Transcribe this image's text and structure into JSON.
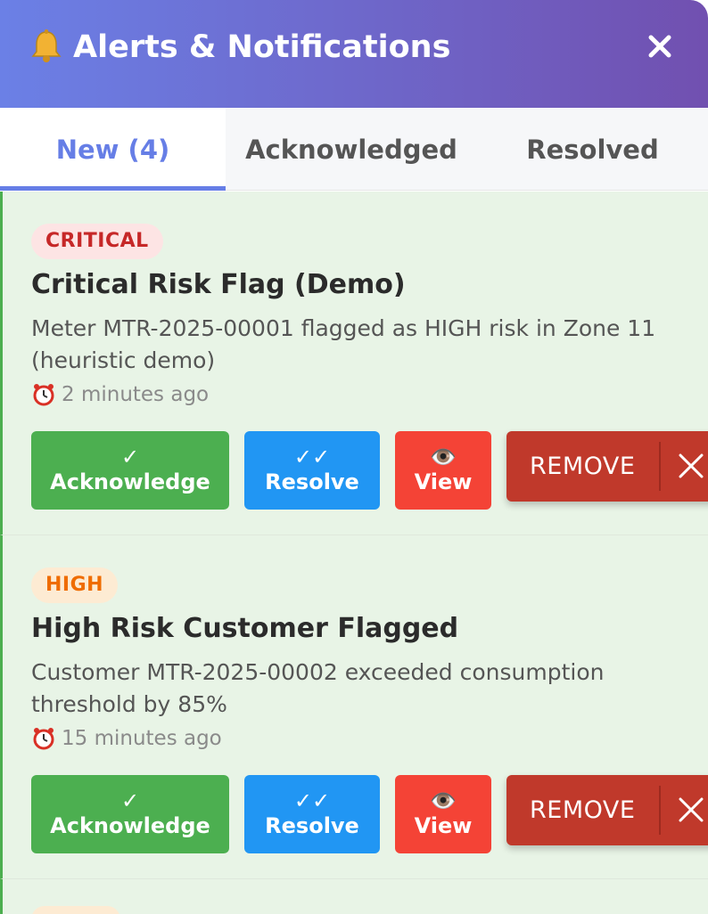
{
  "header": {
    "title": "Alerts & Notifications",
    "bell_icon": "bell-icon",
    "close_icon": "close-icon",
    "gradient": [
      "#6b80e6",
      "#7150b0"
    ]
  },
  "tabs": [
    {
      "label": "New (4)",
      "active": true
    },
    {
      "label": "Acknowledged",
      "active": false
    },
    {
      "label": "Resolved",
      "active": false
    }
  ],
  "alerts": [
    {
      "severity": "CRITICAL",
      "title": "Critical Risk Flag (Demo)",
      "message": "Meter MTR-2025-00001 flagged as HIGH risk in Zone 11 (heuristic demo)",
      "time": "2 minutes ago"
    },
    {
      "severity": "HIGH",
      "title": "High Risk Customer Flagged",
      "message": "Customer MTR-2025-00002 exceeded consumption threshold by 85%",
      "time": "15 minutes ago"
    }
  ],
  "actions": {
    "acknowledge_glyph": "✓",
    "acknowledge_label": "Acknowledge",
    "resolve_glyph": "✓✓",
    "resolve_label": "Resolve",
    "view_glyph": "👁️",
    "view_label": "View",
    "remove_label": "REMOVE"
  },
  "colors": {
    "accent": "#667ee6",
    "acknowledge": "#4caf50",
    "resolve": "#2196f3",
    "view": "#f44336",
    "remove": "#c0392b",
    "critical": "#c62828",
    "high": "#ef6c00"
  }
}
